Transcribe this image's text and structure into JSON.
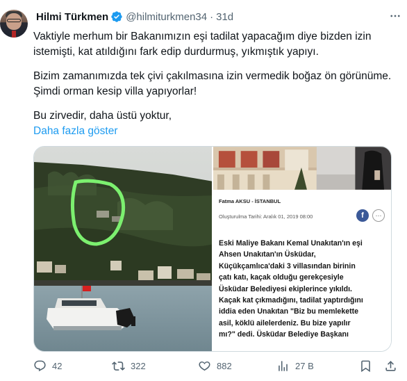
{
  "tweet": {
    "author_name": "Hilmi Türkmen",
    "author_handle": "@hilmiturkmen34",
    "separator": "·",
    "time_ago": "31d",
    "lines": [
      "Vaktiyle merhum bir Bakanımızın eşi tadilat yapacağım diye bizden izin",
      "istemişti, kat atıldığını fark edip durdurmuş, yıkmıştık yapıyı.",
      "Bizim zamanımızda tek çivi çakılmasına izin vermedik boğaz ön görünüme.",
      "Şimdi orman kesip villa yapıyorlar!",
      "Bu zirvedir, daha üstü yoktur,"
    ],
    "show_more": "Daha fazla göster"
  },
  "media": {
    "news": {
      "byline": "Fatma AKSU - İSTANBUL",
      "date": "Oluşturulma Tarihi: Aralık 01, 2019 08:00",
      "facebook_glyph": "f",
      "more_glyph": "···",
      "article_lines": [
        "Eski Maliye Bakanı Kemal Unakıtan'ın eşi",
        "Ahsen Unakıtan'ın Üsküdar,",
        "Küçükçamlıca'daki 3 villasından birinin",
        "çatı katı, kaçak olduğu gerekçesiyle",
        "Üsküdar Belediyesi ekiplerince yıkıldı.",
        "Kaçak kat çıkmadığını, tadilat yaptırdığını",
        "iddia eden Unakıtan \"Biz bu memlekette",
        "asil, köklü ailelerdeniz. Bu bize yapılır",
        "mı?\" dedi. Üsküdar Belediye Başkanı"
      ]
    }
  },
  "actions": {
    "replies": "42",
    "retweets": "322",
    "likes": "882",
    "views": "27 B"
  },
  "icons": {
    "verified": "verified-badge-icon",
    "more": "more-horizontal-icon",
    "reply": "reply-icon",
    "retweet": "retweet-icon",
    "like": "heart-icon",
    "views": "views-chart-icon",
    "bookmark": "bookmark-icon",
    "share": "share-icon"
  },
  "colors": {
    "text": "#0f1419",
    "muted": "#536471",
    "link": "#1d9bf0",
    "verified": "#1d9bf0",
    "highlight_circle": "#7cf06f"
  }
}
